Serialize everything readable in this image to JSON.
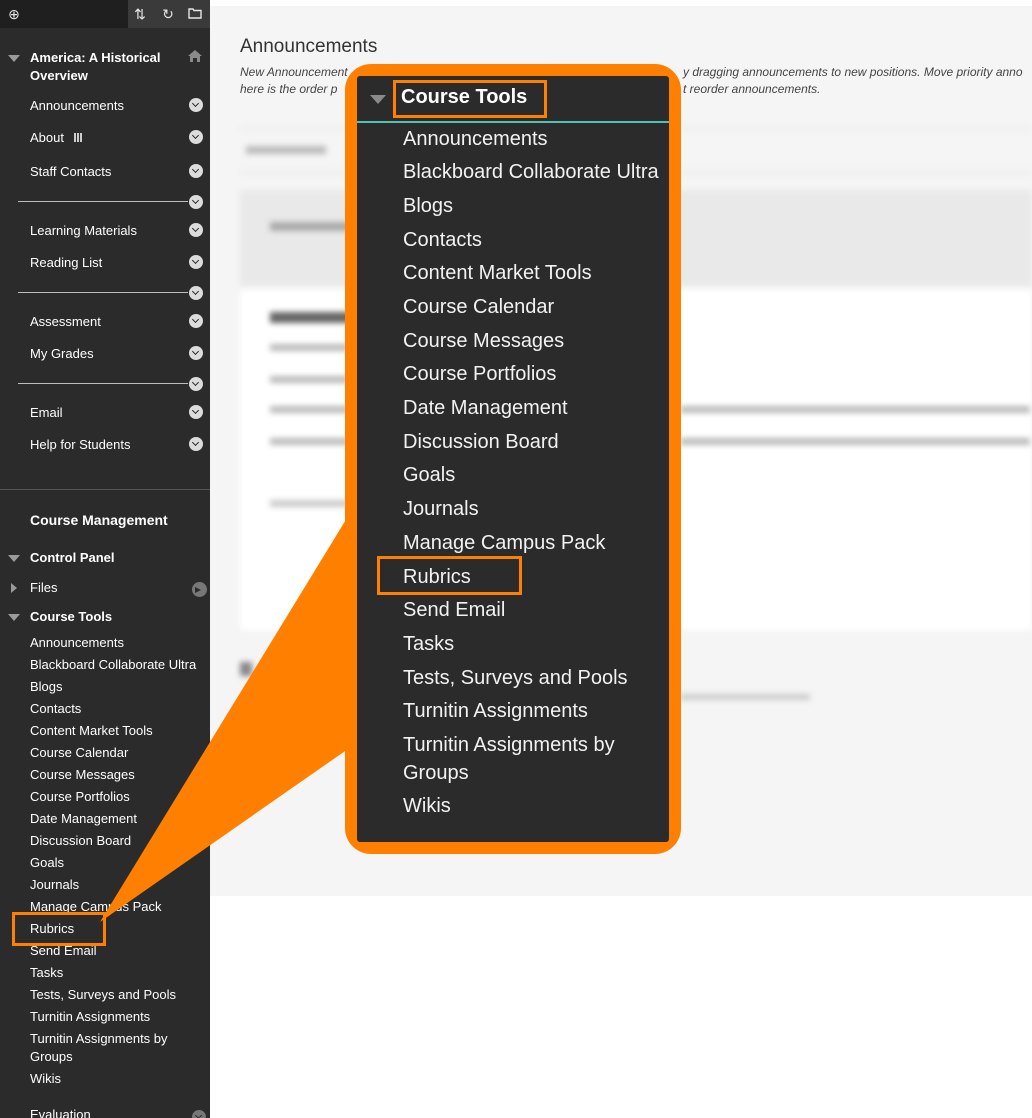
{
  "topbar": {
    "icons": [
      "plus-circle-icon",
      "sort-arrows-icon",
      "refresh-icon",
      "folder-icon"
    ]
  },
  "sidebar": {
    "course_title": "America: A Historical Overview",
    "menu": {
      "announcements": "Announcements",
      "about": "About",
      "staff_contacts": "Staff Contacts",
      "learning_materials": "Learning Materials",
      "reading_list": "Reading List",
      "assessment": "Assessment",
      "my_grades": "My Grades",
      "email": "Email",
      "help_for_students": "Help for Students"
    },
    "course_management": "Course Management",
    "control_panel": "Control Panel",
    "files": "Files",
    "course_tools_heading": "Course Tools",
    "course_tools": [
      "Announcements",
      "Blackboard Collaborate Ultra",
      "Blogs",
      "Contacts",
      "Content Market Tools",
      "Course Calendar",
      "Course Messages",
      "Course Portfolios",
      "Date Management",
      "Discussion Board",
      "Goals",
      "Journals",
      "Manage Campus Pack",
      "Rubrics",
      "Send Email",
      "Tasks",
      "Tests, Surveys and Pools",
      "Turnitin Assignments",
      "Turnitin Assignments by Groups",
      "Wikis"
    ],
    "evaluation": "Evaluation"
  },
  "main": {
    "title": "Announcements",
    "desc_line1": "New Announcement",
    "desc_line1_right": "y dragging announcements to new positions. Move priority anno",
    "desc_line2": "here is the order p",
    "desc_line2_right": "t reorder announcements."
  },
  "zoom": {
    "heading": "Course Tools",
    "items": [
      "Announcements",
      "Blackboard Collaborate Ultra",
      "Blogs",
      "Contacts",
      "Content Market Tools",
      "Course Calendar",
      "Course Messages",
      "Course Portfolios",
      "Date Management",
      "Discussion Board",
      "Goals",
      "Journals",
      "Manage Campus Pack",
      "Rubrics",
      "Send Email",
      "Tasks",
      "Tests, Surveys and Pools",
      "Turnitin Assignments",
      "Turnitin Assignments by Groups",
      "Wikis"
    ]
  },
  "colors": {
    "sidebar_bg": "#2b2b2b",
    "highlight": "#ff8000",
    "accent_line": "#4fc3b0"
  }
}
